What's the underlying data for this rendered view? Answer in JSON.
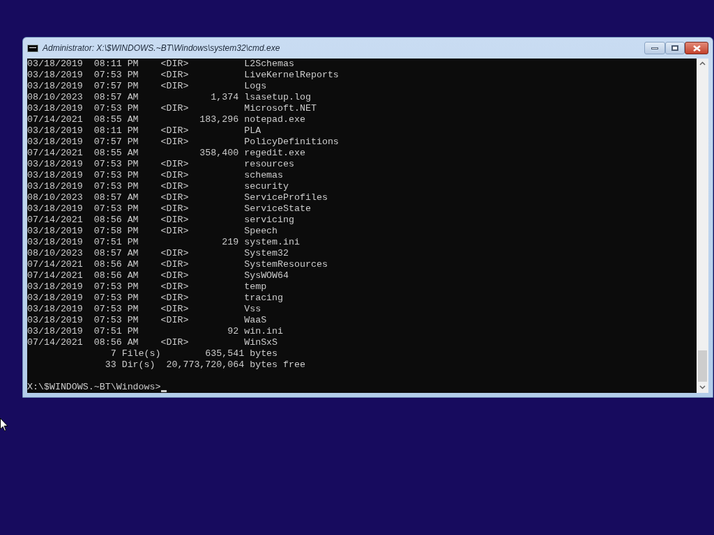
{
  "window": {
    "title": "Administrator: X:\\$WINDOWS.~BT\\Windows\\system32\\cmd.exe"
  },
  "console": {
    "lines": [
      "03/18/2019  08:11 PM    <DIR>          L2Schemas",
      "03/18/2019  07:53 PM    <DIR>          LiveKernelReports",
      "03/18/2019  07:57 PM    <DIR>          Logs",
      "08/10/2023  08:57 AM             1,374 lsasetup.log",
      "03/18/2019  07:53 PM    <DIR>          Microsoft.NET",
      "07/14/2021  08:55 AM           183,296 notepad.exe",
      "03/18/2019  08:11 PM    <DIR>          PLA",
      "03/18/2019  07:57 PM    <DIR>          PolicyDefinitions",
      "07/14/2021  08:55 AM           358,400 regedit.exe",
      "03/18/2019  07:53 PM    <DIR>          resources",
      "03/18/2019  07:53 PM    <DIR>          schemas",
      "03/18/2019  07:53 PM    <DIR>          security",
      "08/10/2023  08:57 AM    <DIR>          ServiceProfiles",
      "03/18/2019  07:53 PM    <DIR>          ServiceState",
      "07/14/2021  08:56 AM    <DIR>          servicing",
      "03/18/2019  07:58 PM    <DIR>          Speech",
      "03/18/2019  07:51 PM               219 system.ini",
      "08/10/2023  08:57 AM    <DIR>          System32",
      "07/14/2021  08:56 AM    <DIR>          SystemResources",
      "07/14/2021  08:56 AM    <DIR>          SysWOW64",
      "03/18/2019  07:53 PM    <DIR>          temp",
      "03/18/2019  07:53 PM    <DIR>          tracing",
      "03/18/2019  07:53 PM    <DIR>          Vss",
      "03/18/2019  07:53 PM    <DIR>          WaaS",
      "03/18/2019  07:51 PM                92 win.ini",
      "07/14/2021  08:56 AM    <DIR>          WinSxS",
      "               7 File(s)        635,541 bytes",
      "              33 Dir(s)  20,773,720,064 bytes free"
    ],
    "prompt": "X:\\$WINDOWS.~BT\\Windows>"
  }
}
